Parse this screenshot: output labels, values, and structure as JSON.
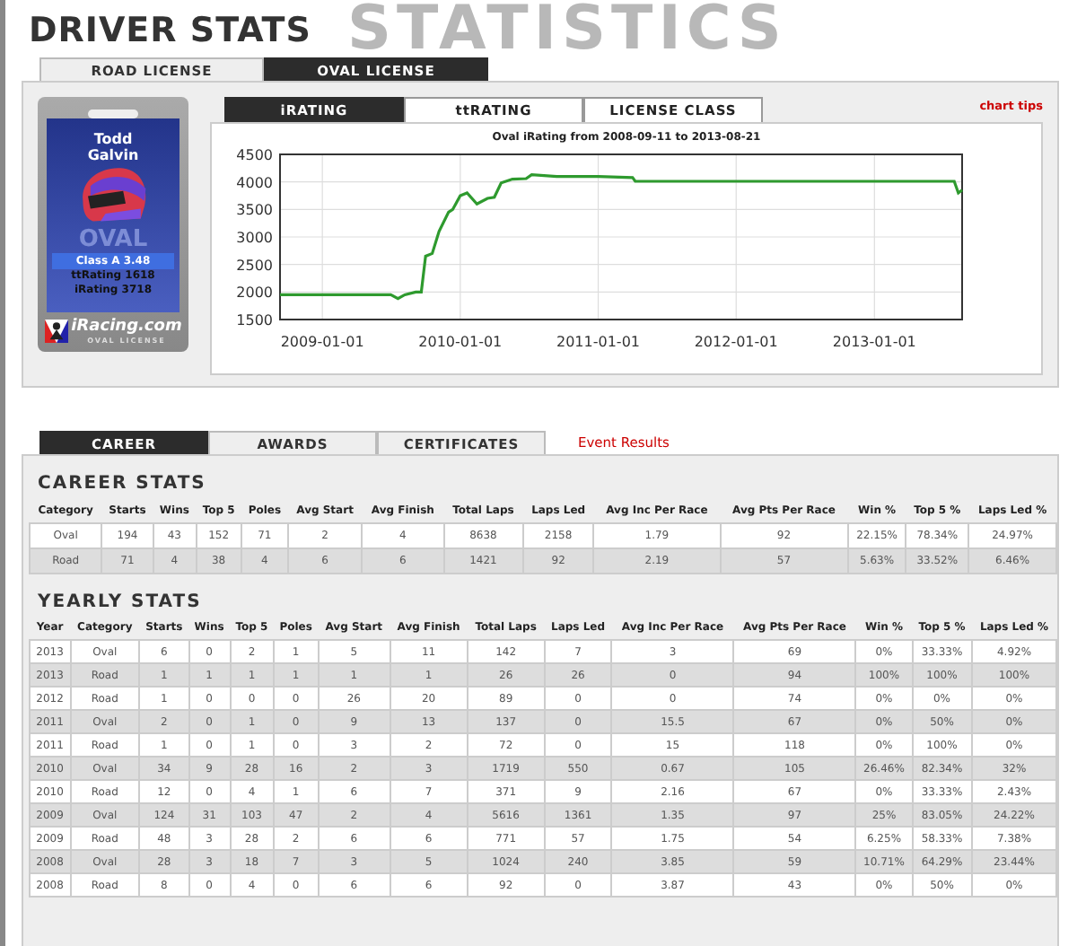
{
  "background_title": "STATISTICS",
  "page_title": "DRIVER STATS",
  "license_tabs": [
    {
      "label": "ROAD LICENSE",
      "selected": false
    },
    {
      "label": "OVAL LICENSE",
      "selected": true
    }
  ],
  "card": {
    "first_name": "Todd",
    "last_name": "Galvin",
    "watermark": "OVAL",
    "class": "Class A 3.48",
    "tt_rating": "ttRating 1618",
    "irating": "iRating 3718",
    "logo": "iRacing.com",
    "logo_sub": "OVAL LICENSE"
  },
  "rating_tabs": [
    {
      "label": "iRATING",
      "selected": true
    },
    {
      "label": "ttRATING",
      "selected": false
    },
    {
      "label": "LICENSE CLASS",
      "selected": false
    }
  ],
  "chart_tips": "chart tips",
  "chart": {
    "chart_data": {
      "type": "line",
      "title": "Oval iRating from 2008-09-11 to 2013-08-21",
      "x": [
        "2008-09-11",
        "2009-07-01",
        "2009-07-20",
        "2009-08-07",
        "2009-09-05",
        "2009-09-20",
        "2009-10-01",
        "2009-10-19",
        "2009-11-06",
        "2009-12-01",
        "2009-12-12",
        "2010-01-01",
        "2010-01-19",
        "2010-02-14",
        "2010-03-14",
        "2010-04-01",
        "2010-04-19",
        "2010-05-19",
        "2010-06-24",
        "2010-07-09",
        "2010-09-13",
        "2011-01-01",
        "2011-04-02",
        "2011-04-09",
        "2013-07-31",
        "2013-08-11",
        "2013-08-21"
      ],
      "series": [
        {
          "color": "#2e9a2e",
          "values": [
            1950,
            1950,
            1880,
            1950,
            2000,
            2000,
            2650,
            2700,
            3100,
            3450,
            3500,
            3750,
            3800,
            3600,
            3700,
            3720,
            3980,
            4050,
            4060,
            4130,
            4100,
            4100,
            4080,
            4010,
            4010,
            3800,
            3850
          ]
        }
      ],
      "xlim": [
        "2008-09-11",
        "2013-08-21"
      ],
      "ylim": [
        1500,
        4500
      ],
      "grid": true,
      "xticks": [
        "2009-01-01",
        "2010-01-01",
        "2011-01-01",
        "2012-01-01",
        "2013-01-01"
      ],
      "yticks": [
        1500,
        2000,
        2500,
        3000,
        3500,
        4000,
        4500
      ]
    }
  },
  "section_tabs": [
    {
      "label": "CAREER",
      "selected": true
    },
    {
      "label": "AWARDS",
      "selected": false
    },
    {
      "label": "CERTIFICATES",
      "selected": false
    }
  ],
  "event_results": "Event Results",
  "career": {
    "title": "CAREER STATS",
    "columns": [
      "Category",
      "Starts",
      "Wins",
      "Top 5",
      "Poles",
      "Avg Start",
      "Avg Finish",
      "Total Laps",
      "Laps Led",
      "Avg Inc Per Race",
      "Avg Pts Per Race",
      "Win %",
      "Top 5 %",
      "Laps Led %"
    ],
    "rows": [
      [
        "Oval",
        "194",
        "43",
        "152",
        "71",
        "2",
        "4",
        "8638",
        "2158",
        "1.79",
        "92",
        "22.15%",
        "78.34%",
        "24.97%"
      ],
      [
        "Road",
        "71",
        "4",
        "38",
        "4",
        "6",
        "6",
        "1421",
        "92",
        "2.19",
        "57",
        "5.63%",
        "33.52%",
        "6.46%"
      ]
    ]
  },
  "yearly": {
    "title": "YEARLY STATS",
    "columns": [
      "Year",
      "Category",
      "Starts",
      "Wins",
      "Top 5",
      "Poles",
      "Avg Start",
      "Avg Finish",
      "Total Laps",
      "Laps Led",
      "Avg Inc Per Race",
      "Avg Pts Per Race",
      "Win %",
      "Top 5 %",
      "Laps Led %"
    ],
    "rows": [
      [
        "2013",
        "Oval",
        "6",
        "0",
        "2",
        "1",
        "5",
        "11",
        "142",
        "7",
        "3",
        "69",
        "0%",
        "33.33%",
        "4.92%"
      ],
      [
        "2013",
        "Road",
        "1",
        "1",
        "1",
        "1",
        "1",
        "1",
        "26",
        "26",
        "0",
        "94",
        "100%",
        "100%",
        "100%"
      ],
      [
        "2012",
        "Road",
        "1",
        "0",
        "0",
        "0",
        "26",
        "20",
        "89",
        "0",
        "0",
        "74",
        "0%",
        "0%",
        "0%"
      ],
      [
        "2011",
        "Oval",
        "2",
        "0",
        "1",
        "0",
        "9",
        "13",
        "137",
        "0",
        "15.5",
        "67",
        "0%",
        "50%",
        "0%"
      ],
      [
        "2011",
        "Road",
        "1",
        "0",
        "1",
        "0",
        "3",
        "2",
        "72",
        "0",
        "15",
        "118",
        "0%",
        "100%",
        "0%"
      ],
      [
        "2010",
        "Oval",
        "34",
        "9",
        "28",
        "16",
        "2",
        "3",
        "1719",
        "550",
        "0.67",
        "105",
        "26.46%",
        "82.34%",
        "32%"
      ],
      [
        "2010",
        "Road",
        "12",
        "0",
        "4",
        "1",
        "6",
        "7",
        "371",
        "9",
        "2.16",
        "67",
        "0%",
        "33.33%",
        "2.43%"
      ],
      [
        "2009",
        "Oval",
        "124",
        "31",
        "103",
        "47",
        "2",
        "4",
        "5616",
        "1361",
        "1.35",
        "97",
        "25%",
        "83.05%",
        "24.22%"
      ],
      [
        "2009",
        "Road",
        "48",
        "3",
        "28",
        "2",
        "6",
        "6",
        "771",
        "57",
        "1.75",
        "54",
        "6.25%",
        "58.33%",
        "7.38%"
      ],
      [
        "2008",
        "Oval",
        "28",
        "3",
        "18",
        "7",
        "3",
        "5",
        "1024",
        "240",
        "3.85",
        "59",
        "10.71%",
        "64.29%",
        "23.44%"
      ],
      [
        "2008",
        "Road",
        "8",
        "0",
        "4",
        "0",
        "6",
        "6",
        "92",
        "0",
        "3.87",
        "43",
        "0%",
        "50%",
        "0%"
      ]
    ]
  }
}
